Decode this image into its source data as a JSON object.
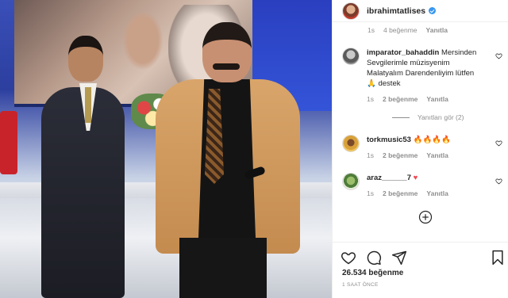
{
  "post": {
    "username": "ibrahimtatlises",
    "verified": true,
    "likes_text": "26.534 beğenme",
    "time_ago": "1 SAAT ÖNCE"
  },
  "top_partial_meta": {
    "time": "1s",
    "likes": "4 beğenme",
    "reply": "Yanıtla"
  },
  "comments": [
    {
      "username": "imparator_bahaddin",
      "text": "Mersinden Sevgilerimle müzisyenim Malatyalım Darendenliyim lütfen",
      "emoji": "🙏",
      "text_tail": "destek",
      "time": "1s",
      "likes": "2 beğenme",
      "reply": "Yanıtla"
    },
    {
      "username": "torkmusic53",
      "text": "",
      "emoji": "🔥🔥🔥🔥",
      "time": "1s",
      "likes": "2 beğenme",
      "reply": "Yanıtla"
    },
    {
      "username": "araz______7",
      "text": "",
      "emoji": "♥",
      "time": "1s",
      "likes": "2 beğenme",
      "reply": "Yanıtla"
    }
  ],
  "view_replies": "Yanıtları gör (2)",
  "icons": {
    "like": "heart-icon",
    "comment": "comment-icon",
    "share": "share-icon",
    "save": "bookmark-icon",
    "more": "plus-circle-icon"
  },
  "colors": {
    "verified": "#3897f0",
    "muted": "#8e8e8e",
    "text": "#262626",
    "heart_red": "#ed4956"
  }
}
